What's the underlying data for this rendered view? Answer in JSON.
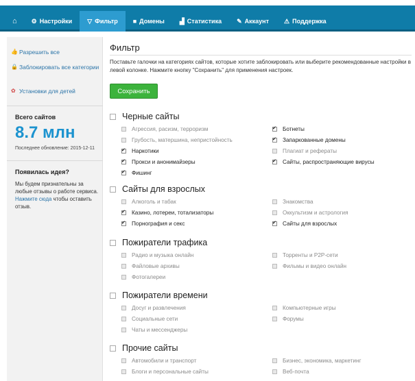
{
  "nav": {
    "items": [
      {
        "icon": "home-icon",
        "label": ""
      },
      {
        "icon": "settings-icon",
        "label": "Настройки"
      },
      {
        "icon": "filter-icon",
        "label": "Фильтр"
      },
      {
        "icon": "domains-icon",
        "label": "Домены"
      },
      {
        "icon": "stats-icon",
        "label": "Статистика"
      },
      {
        "icon": "account-icon",
        "label": "Аккаунт"
      },
      {
        "icon": "support-icon",
        "label": "Поддержка"
      }
    ],
    "active": "Фильтр"
  },
  "sidebar": {
    "allow_all": "Разрешить все",
    "block_all": "Заблокировать все категории",
    "kids": "Установки для детей",
    "total_label": "Всего сайтов",
    "total_value": "8.7 млн",
    "updated": "Последнее обновление: 2015-12-11",
    "idea_title": "Появилась идея?",
    "idea_text": "Мы будем признательны за любые отзывы о работе сервиса.",
    "idea_link": "Нажмите сюда",
    "idea_tail": "чтобы оставить отзыв."
  },
  "main": {
    "title": "Фильтр",
    "description": "Поставьте галочки на категориях сайтов, которые хотите заблокировать или выберите рекомендованные настройки в левой колонке. Нажмите кнопку \"Сохранить\" для применения настроек.",
    "save_label": "Сохранить"
  },
  "categories": [
    {
      "title": "Черные сайты",
      "items": [
        {
          "label": "Агрессия, расизм, терроризм",
          "checked": false
        },
        {
          "label": "Ботнеты",
          "checked": true
        },
        {
          "label": "Грубость, матершина, непристойность",
          "checked": false
        },
        {
          "label": "Запаркованные домены",
          "checked": true
        },
        {
          "label": "Наркотики",
          "checked": true
        },
        {
          "label": "Плагиат и рефераты",
          "checked": false
        },
        {
          "label": "Прокси и анонимайзеры",
          "checked": true
        },
        {
          "label": "Сайты, распространяющие вирусы",
          "checked": true
        },
        {
          "label": "Фишинг",
          "checked": true
        }
      ]
    },
    {
      "title": "Сайты для взрослых",
      "items": [
        {
          "label": "Алкоголь и табак",
          "checked": false
        },
        {
          "label": "Знакомства",
          "checked": false
        },
        {
          "label": "Казино, лотереи, тотализаторы",
          "checked": true
        },
        {
          "label": "Оккультизм и астрология",
          "checked": false
        },
        {
          "label": "Порнография и секс",
          "checked": true
        },
        {
          "label": "Сайты для взрослых",
          "checked": true
        }
      ]
    },
    {
      "title": "Пожиратели трафика",
      "items": [
        {
          "label": "Радио и музыка онлайн",
          "checked": false
        },
        {
          "label": "Торренты и P2P-сети",
          "checked": false
        },
        {
          "label": "Файловые архивы",
          "checked": false
        },
        {
          "label": "Фильмы и видео онлайн",
          "checked": false
        },
        {
          "label": "Фотогалереи",
          "checked": false
        }
      ]
    },
    {
      "title": "Пожиратели времени",
      "items": [
        {
          "label": "Досуг и развлечения",
          "checked": false
        },
        {
          "label": "Компьютерные игры",
          "checked": false
        },
        {
          "label": "Социальные сети",
          "checked": false
        },
        {
          "label": "Форумы",
          "checked": false
        },
        {
          "label": "Чаты и мессенджеры",
          "checked": false
        }
      ]
    },
    {
      "title": "Прочие сайты",
      "items": [
        {
          "label": "Автомобили и транспорт",
          "checked": false
        },
        {
          "label": "Бизнес, экономика, маркетинг",
          "checked": false
        },
        {
          "label": "Блоги и персональные сайты",
          "checked": false
        },
        {
          "label": "Веб-почта",
          "checked": false
        }
      ]
    }
  ]
}
